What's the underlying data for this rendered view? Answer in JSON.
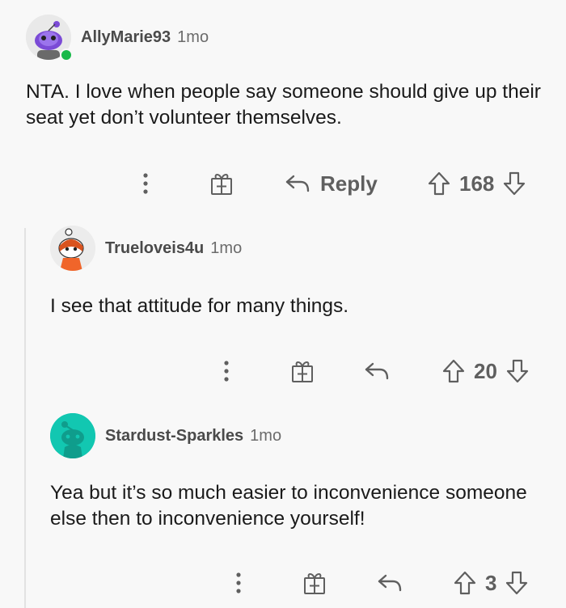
{
  "comments": [
    {
      "username": "AllyMarie93",
      "time": "1mo",
      "body": "NTA. I love when people say someone should give up their seat yet don’t volunteer themselves.",
      "reply_label": "Reply",
      "score": "168",
      "online": true
    },
    {
      "username": "Trueloveis4u",
      "time": "1mo",
      "body": "I see that attitude for many things.",
      "score": "20"
    },
    {
      "username": "Stardust-Sparkles",
      "time": "1mo",
      "body": "Yea but it’s so much easier to inconvenience someone else then to inconvenience yourself!",
      "score": "3"
    }
  ],
  "icons": {
    "more": "more-options-icon",
    "award": "award-icon",
    "reply": "reply-arrow-icon",
    "upvote": "upvote-arrow-icon",
    "downvote": "downvote-arrow-icon"
  },
  "colors": {
    "background": "#f8f8f8",
    "icon_gray": "#5f5f5f",
    "online_green": "#19b94a",
    "avatar_teal": "#12c7b1",
    "avatar_purple": "#7b4bd6"
  }
}
